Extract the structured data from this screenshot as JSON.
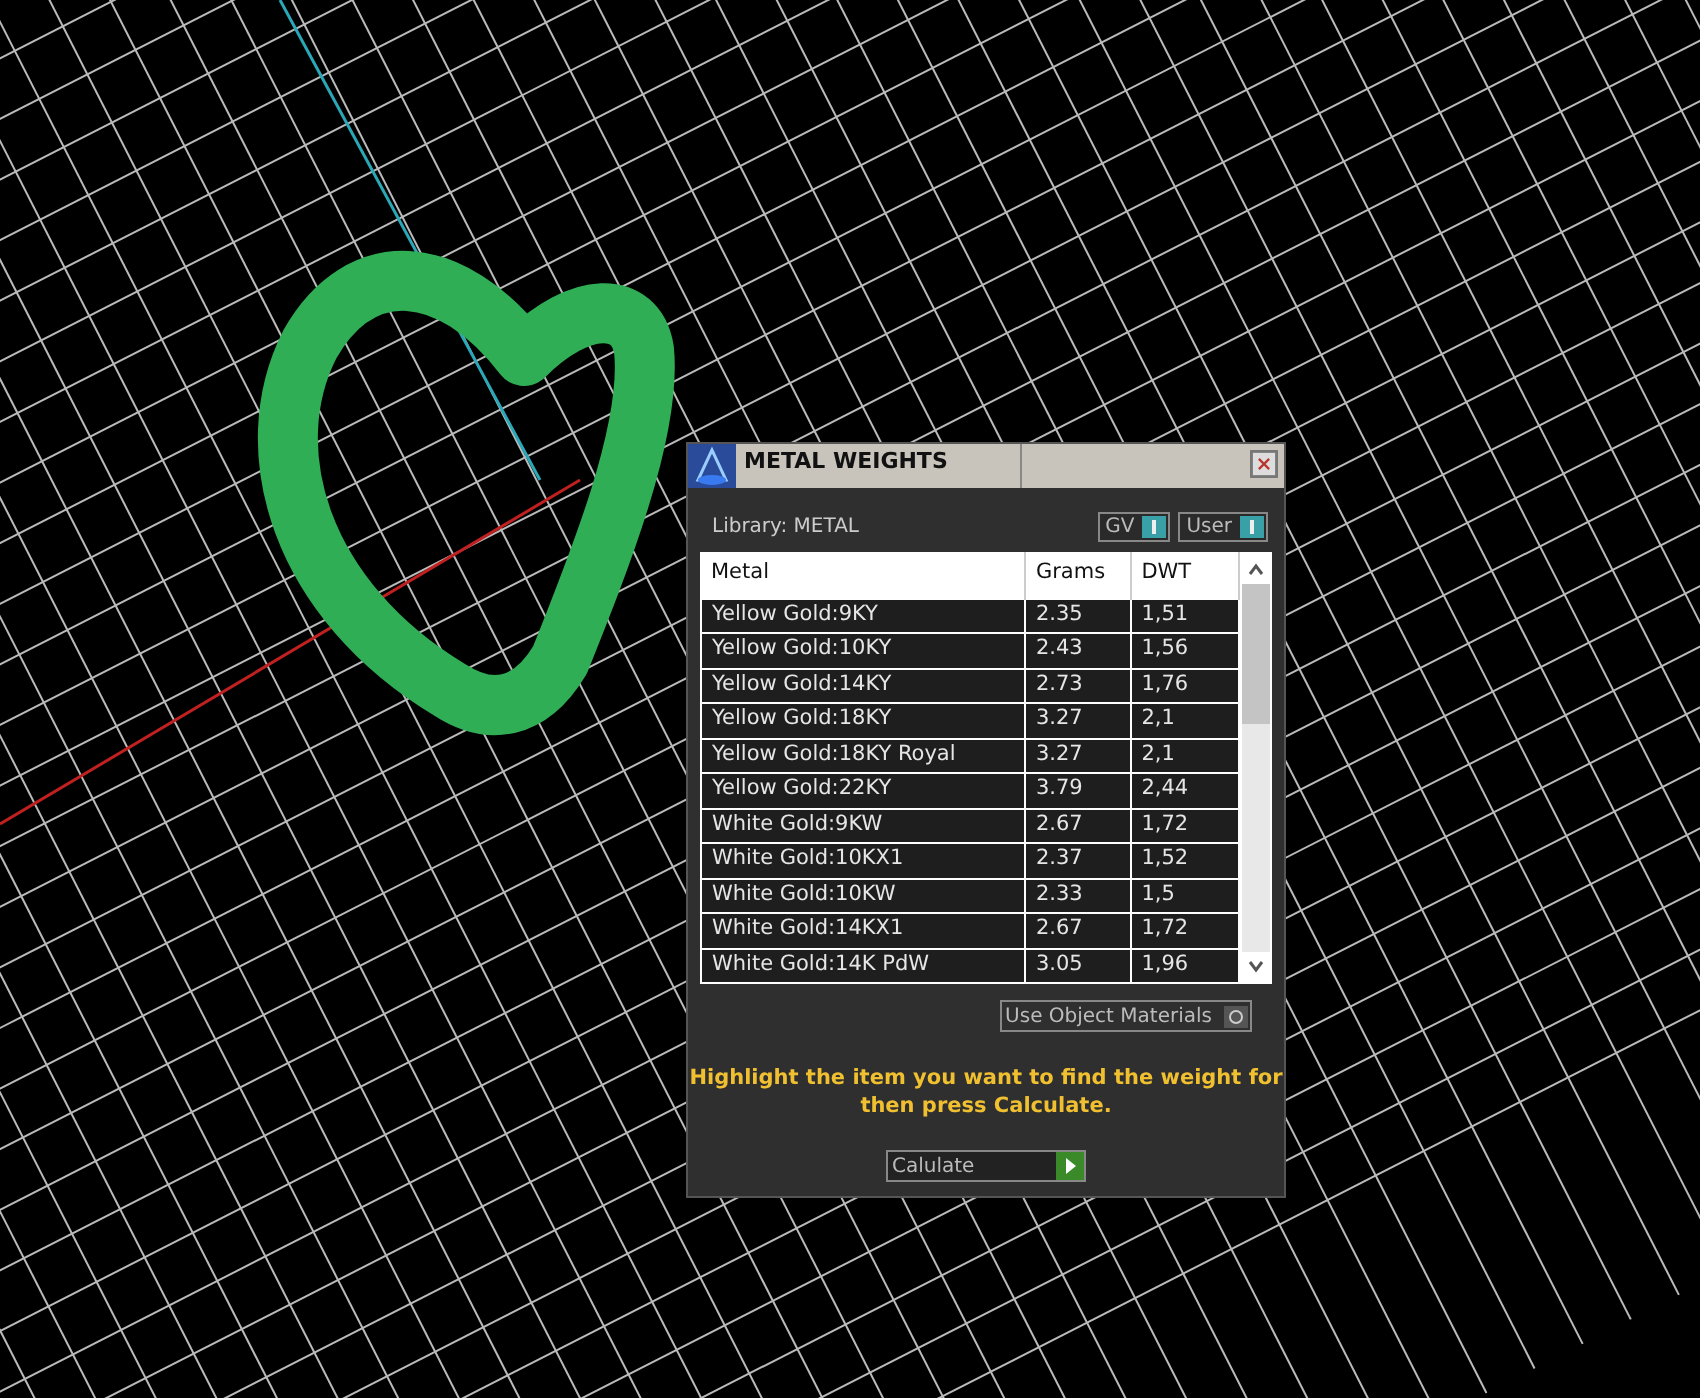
{
  "dialog": {
    "title": "METAL WEIGHTS",
    "library_label": "Library: METAL",
    "toggles": [
      {
        "label": "GV",
        "on": true
      },
      {
        "label": "User",
        "on": true
      }
    ],
    "table": {
      "columns": [
        "Metal",
        "Grams",
        "DWT"
      ],
      "rows": [
        {
          "cells": [
            "Yellow Gold:9KY",
            "2.35",
            "1,51"
          ],
          "selected": false
        },
        {
          "cells": [
            "Yellow Gold:10KY",
            "2.43",
            "1,56"
          ],
          "selected": false
        },
        {
          "cells": [
            "Yellow Gold:14KY",
            "2.73",
            "1,76"
          ],
          "selected": false
        },
        {
          "cells": [
            "Yellow Gold:18KY",
            "3.27",
            "2,1"
          ],
          "selected": false
        },
        {
          "cells": [
            "Yellow Gold:18KY Royal",
            "3.27",
            "2,1"
          ],
          "selected": false
        },
        {
          "cells": [
            "Yellow Gold:22KY",
            "3.79",
            "2,44"
          ],
          "selected": false
        },
        {
          "cells": [
            "White Gold:9KW",
            "2.67",
            "1,72"
          ],
          "selected": false
        },
        {
          "cells": [
            "White Gold:10KX1",
            "2.37",
            "1,52"
          ],
          "selected": false
        },
        {
          "cells": [
            "White Gold:10KW",
            "2.33",
            "1,5"
          ],
          "selected": false
        },
        {
          "cells": [
            "White Gold:14KX1",
            "2.67",
            "1,72"
          ],
          "selected": false
        },
        {
          "cells": [
            "White Gold:14K PdW",
            "3.05",
            "1,96"
          ],
          "selected": false
        }
      ]
    },
    "use_object_materials": {
      "label": "Use Object Materials",
      "on": false
    },
    "hint": "Highlight the item you want to find the weight for then press Calculate.",
    "calculate_button": "Calulate"
  }
}
